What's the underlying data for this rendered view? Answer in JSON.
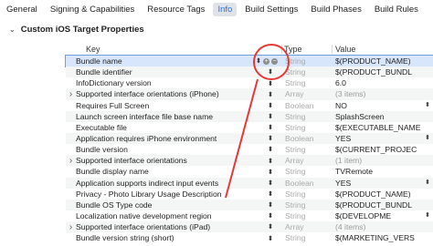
{
  "tabs": [
    {
      "label": "General",
      "active": false
    },
    {
      "label": "Signing & Capabilities",
      "active": false
    },
    {
      "label": "Resource Tags",
      "active": false
    },
    {
      "label": "Info",
      "active": true
    },
    {
      "label": "Build Settings",
      "active": false
    },
    {
      "label": "Build Phases",
      "active": false
    },
    {
      "label": "Build Rules",
      "active": false
    }
  ],
  "section": {
    "title": "Custom iOS Target Properties"
  },
  "table": {
    "headers": {
      "key": "Key",
      "type": "Type",
      "value": "Value"
    },
    "rows": [
      {
        "key": "Bundle name",
        "type": "String",
        "value": "$(PRODUCT_NAME)",
        "expandable": false,
        "selected": true
      },
      {
        "key": "Bundle identifier",
        "type": "String",
        "value": "$(PRODUCT_BUNDL",
        "expandable": false
      },
      {
        "key": "InfoDictionary version",
        "type": "String",
        "value": "6.0",
        "expandable": false
      },
      {
        "key": "Supported interface orientations (iPhone)",
        "type": "Array",
        "value": "(3 items)",
        "expandable": true
      },
      {
        "key": "Requires Full Screen",
        "type": "Boolean",
        "value": "NO",
        "expandable": false,
        "value_stepper": true
      },
      {
        "key": "Launch screen interface file base name",
        "type": "String",
        "value": "SplashScreen",
        "expandable": false
      },
      {
        "key": "Executable file",
        "type": "String",
        "value": "$(EXECUTABLE_NAME",
        "expandable": false
      },
      {
        "key": "Application requires iPhone environment",
        "type": "Boolean",
        "value": "YES",
        "expandable": false,
        "value_stepper": true
      },
      {
        "key": "Bundle version",
        "type": "String",
        "value": "$(CURRENT_PROJEC",
        "expandable": false
      },
      {
        "key": "Supported interface orientations",
        "type": "Array",
        "value": "(1 item)",
        "expandable": true
      },
      {
        "key": "Bundle display name",
        "type": "String",
        "value": "TVRemote",
        "expandable": false
      },
      {
        "key": "Application supports indirect input events",
        "type": "Boolean",
        "value": "YES",
        "expandable": false,
        "value_stepper": true
      },
      {
        "key": "Privacy - Photo Library Usage Description",
        "type": "String",
        "value": "$(PRODUCT_NAME)",
        "expandable": false
      },
      {
        "key": "Bundle OS Type code",
        "type": "String",
        "value": "$(PRODUCT_BUNDL",
        "expandable": false
      },
      {
        "key": "Localization native development region",
        "type": "String",
        "value": "$(DEVELOPME",
        "expandable": false,
        "value_stepper": true
      },
      {
        "key": "Supported interface orientations (iPad)",
        "type": "Array",
        "value": "(4 items)",
        "expandable": true
      },
      {
        "key": "Bundle version string (short)",
        "type": "String",
        "value": "$(MARKETING_VERS",
        "expandable": false
      }
    ]
  },
  "icons": {
    "expander": "chevron-right-icon",
    "stepper": "up-down-stepper-icon",
    "add": "plus-circle-icon",
    "remove": "minus-circle-icon"
  },
  "colors": {
    "accent": "#2f6fd6",
    "annotation": "#e53935",
    "selected_row": "#d8e6fb"
  }
}
